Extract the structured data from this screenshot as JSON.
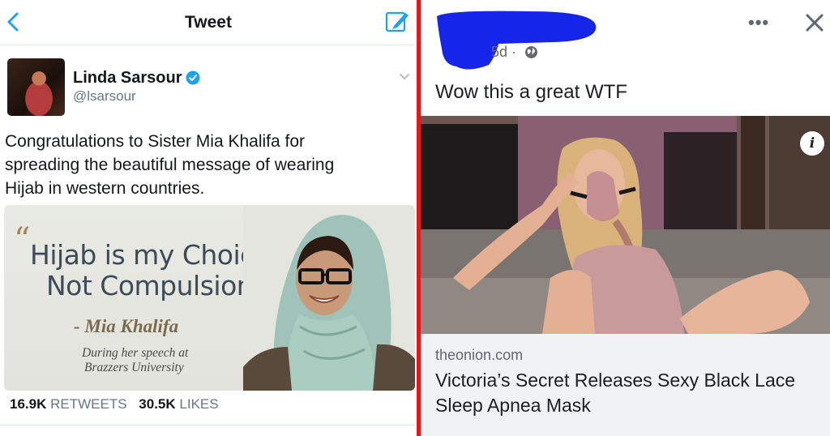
{
  "tweet_view": {
    "header_title": "Tweet",
    "back_icon": "chevron-left-icon",
    "compose_icon": "compose-tweet-icon",
    "user": {
      "display_name": "Linda Sarsour",
      "handle": "@lsarsour",
      "verified_icon": "verified-badge-icon"
    },
    "text_lines": [
      "Congratulations to Sister Mia Khalifa for",
      "spreading the beautiful message of wearing",
      "Hijab in western countries."
    ],
    "quote_card": {
      "quote_mark": "“",
      "line1": "Hijab is my Choice,",
      "line2": "Not Compulsion.",
      "attribution": "- Mia Khalifa",
      "context_line1": "During her speech at",
      "context_line2": "Brazzers University"
    },
    "stats": {
      "retweets_count": "16.9K",
      "retweets_label": "RETWEETS",
      "likes_count": "30.5K",
      "likes_label": "LIKES"
    },
    "accent_color": "#1da1f2"
  },
  "facebook_post": {
    "timestamp": "5d ·",
    "privacy_icon": "globe-icon",
    "more_label": "•••",
    "close_icon": "close-icon",
    "post_text": "Wow this a great WTF",
    "info_label": "i",
    "link_domain": "theonion.com",
    "link_headline": "Victoria’s Secret Releases Sexy Black Lace Sleep Apnea Mask",
    "redaction_color": "#1626e8"
  },
  "divider_color": "#e0191c"
}
